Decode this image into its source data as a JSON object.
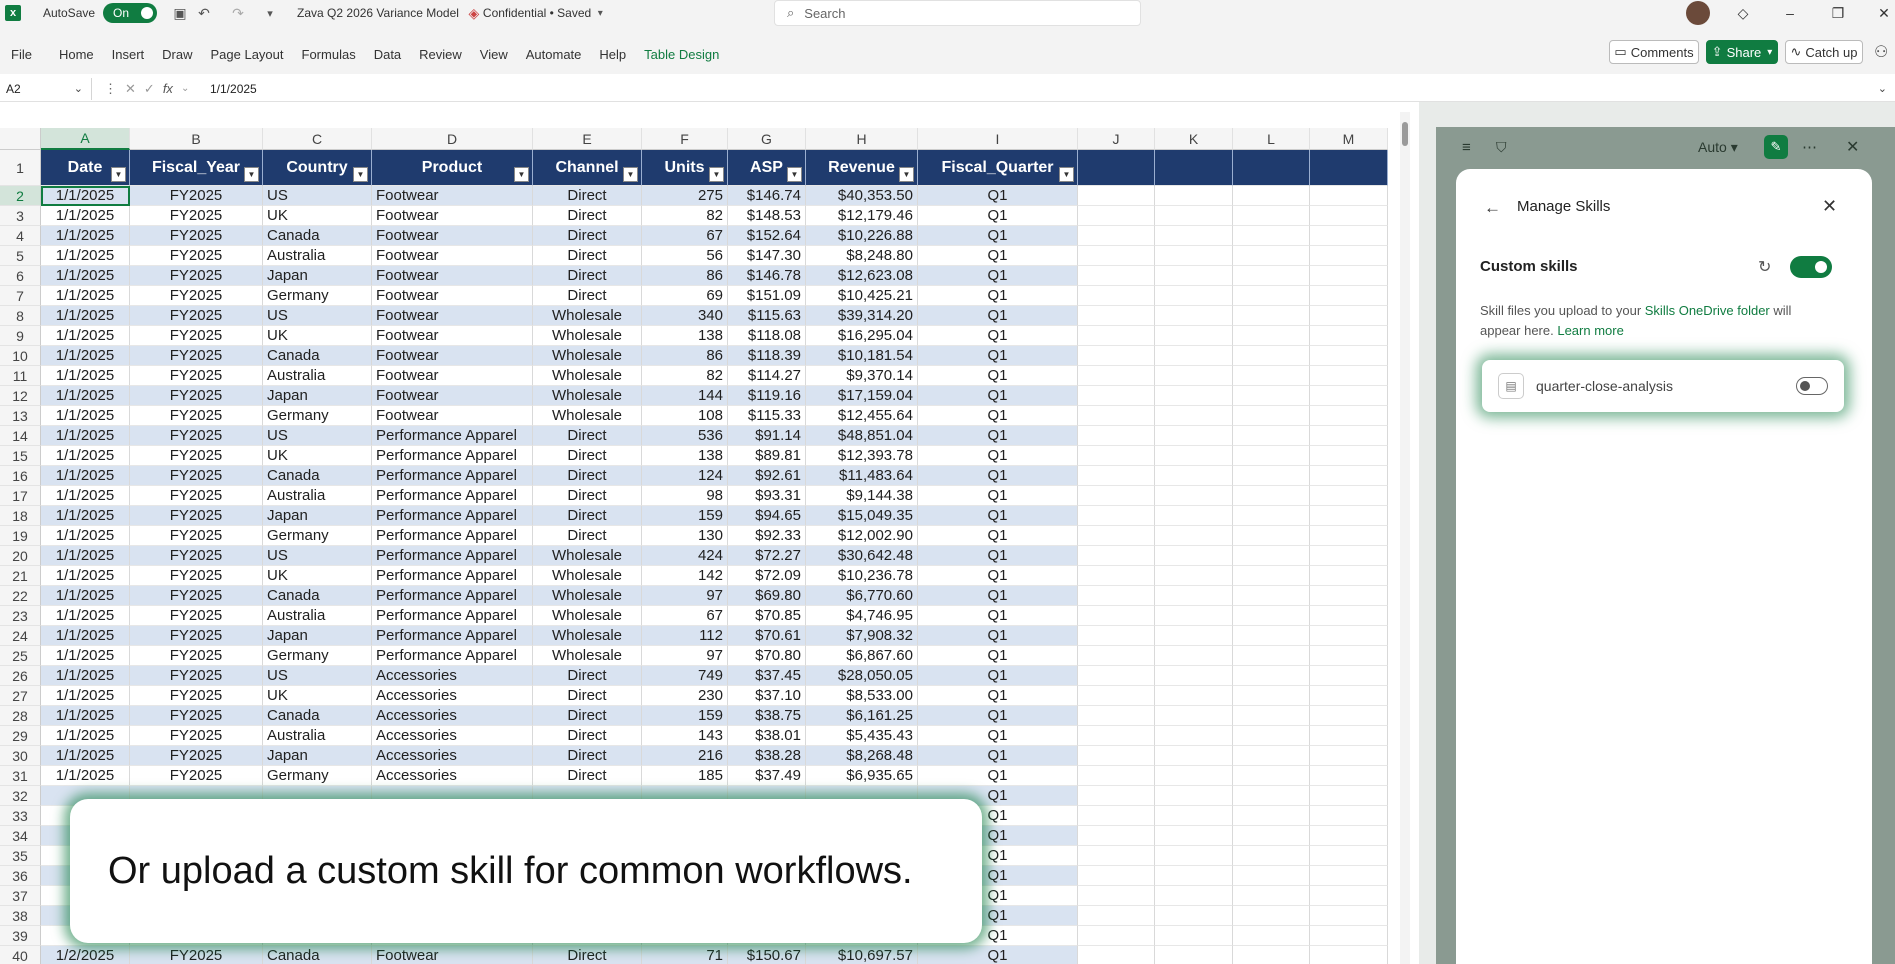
{
  "titlebar": {
    "autosave_label": "AutoSave",
    "autosave_state": "On",
    "doc_title": "Zava Q2 2026 Variance Model",
    "sensitivity": "Confidential • Saved",
    "search_placeholder": "Search"
  },
  "ribbon": {
    "tabs": [
      "File",
      "Home",
      "Insert",
      "Draw",
      "Page Layout",
      "Formulas",
      "Data",
      "Review",
      "View",
      "Automate",
      "Help",
      "Table Design"
    ],
    "active_tab": "Table Design",
    "comments_label": "Comments",
    "share_label": "Share",
    "catchup_label": "Catch up"
  },
  "formula_bar": {
    "name_box": "A2",
    "formula": "1/1/2025"
  },
  "grid": {
    "columns": [
      "A",
      "B",
      "C",
      "D",
      "E",
      "F",
      "G",
      "H",
      "I",
      "J",
      "K",
      "L",
      "M"
    ],
    "headers": [
      "Date",
      "Fiscal_Year",
      "Country",
      "Product",
      "Channel",
      "Units",
      "ASP",
      "Revenue",
      "Fiscal_Quarter"
    ],
    "rows": [
      [
        "1/1/2025",
        "FY2025",
        "US",
        "Footwear",
        "Direct",
        "275",
        "$146.74",
        "$40,353.50",
        "Q1"
      ],
      [
        "1/1/2025",
        "FY2025",
        "UK",
        "Footwear",
        "Direct",
        "82",
        "$148.53",
        "$12,179.46",
        "Q1"
      ],
      [
        "1/1/2025",
        "FY2025",
        "Canada",
        "Footwear",
        "Direct",
        "67",
        "$152.64",
        "$10,226.88",
        "Q1"
      ],
      [
        "1/1/2025",
        "FY2025",
        "Australia",
        "Footwear",
        "Direct",
        "56",
        "$147.30",
        "$8,248.80",
        "Q1"
      ],
      [
        "1/1/2025",
        "FY2025",
        "Japan",
        "Footwear",
        "Direct",
        "86",
        "$146.78",
        "$12,623.08",
        "Q1"
      ],
      [
        "1/1/2025",
        "FY2025",
        "Germany",
        "Footwear",
        "Direct",
        "69",
        "$151.09",
        "$10,425.21",
        "Q1"
      ],
      [
        "1/1/2025",
        "FY2025",
        "US",
        "Footwear",
        "Wholesale",
        "340",
        "$115.63",
        "$39,314.20",
        "Q1"
      ],
      [
        "1/1/2025",
        "FY2025",
        "UK",
        "Footwear",
        "Wholesale",
        "138",
        "$118.08",
        "$16,295.04",
        "Q1"
      ],
      [
        "1/1/2025",
        "FY2025",
        "Canada",
        "Footwear",
        "Wholesale",
        "86",
        "$118.39",
        "$10,181.54",
        "Q1"
      ],
      [
        "1/1/2025",
        "FY2025",
        "Australia",
        "Footwear",
        "Wholesale",
        "82",
        "$114.27",
        "$9,370.14",
        "Q1"
      ],
      [
        "1/1/2025",
        "FY2025",
        "Japan",
        "Footwear",
        "Wholesale",
        "144",
        "$119.16",
        "$17,159.04",
        "Q1"
      ],
      [
        "1/1/2025",
        "FY2025",
        "Germany",
        "Footwear",
        "Wholesale",
        "108",
        "$115.33",
        "$12,455.64",
        "Q1"
      ],
      [
        "1/1/2025",
        "FY2025",
        "US",
        "Performance Apparel",
        "Direct",
        "536",
        "$91.14",
        "$48,851.04",
        "Q1"
      ],
      [
        "1/1/2025",
        "FY2025",
        "UK",
        "Performance Apparel",
        "Direct",
        "138",
        "$89.81",
        "$12,393.78",
        "Q1"
      ],
      [
        "1/1/2025",
        "FY2025",
        "Canada",
        "Performance Apparel",
        "Direct",
        "124",
        "$92.61",
        "$11,483.64",
        "Q1"
      ],
      [
        "1/1/2025",
        "FY2025",
        "Australia",
        "Performance Apparel",
        "Direct",
        "98",
        "$93.31",
        "$9,144.38",
        "Q1"
      ],
      [
        "1/1/2025",
        "FY2025",
        "Japan",
        "Performance Apparel",
        "Direct",
        "159",
        "$94.65",
        "$15,049.35",
        "Q1"
      ],
      [
        "1/1/2025",
        "FY2025",
        "Germany",
        "Performance Apparel",
        "Direct",
        "130",
        "$92.33",
        "$12,002.90",
        "Q1"
      ],
      [
        "1/1/2025",
        "FY2025",
        "US",
        "Performance Apparel",
        "Wholesale",
        "424",
        "$72.27",
        "$30,642.48",
        "Q1"
      ],
      [
        "1/1/2025",
        "FY2025",
        "UK",
        "Performance Apparel",
        "Wholesale",
        "142",
        "$72.09",
        "$10,236.78",
        "Q1"
      ],
      [
        "1/1/2025",
        "FY2025",
        "Canada",
        "Performance Apparel",
        "Wholesale",
        "97",
        "$69.80",
        "$6,770.60",
        "Q1"
      ],
      [
        "1/1/2025",
        "FY2025",
        "Australia",
        "Performance Apparel",
        "Wholesale",
        "67",
        "$70.85",
        "$4,746.95",
        "Q1"
      ],
      [
        "1/1/2025",
        "FY2025",
        "Japan",
        "Performance Apparel",
        "Wholesale",
        "112",
        "$70.61",
        "$7,908.32",
        "Q1"
      ],
      [
        "1/1/2025",
        "FY2025",
        "Germany",
        "Performance Apparel",
        "Wholesale",
        "97",
        "$70.80",
        "$6,867.60",
        "Q1"
      ],
      [
        "1/1/2025",
        "FY2025",
        "US",
        "Accessories",
        "Direct",
        "749",
        "$37.45",
        "$28,050.05",
        "Q1"
      ],
      [
        "1/1/2025",
        "FY2025",
        "UK",
        "Accessories",
        "Direct",
        "230",
        "$37.10",
        "$8,533.00",
        "Q1"
      ],
      [
        "1/1/2025",
        "FY2025",
        "Canada",
        "Accessories",
        "Direct",
        "159",
        "$38.75",
        "$6,161.25",
        "Q1"
      ],
      [
        "1/1/2025",
        "FY2025",
        "Australia",
        "Accessories",
        "Direct",
        "143",
        "$38.01",
        "$5,435.43",
        "Q1"
      ],
      [
        "1/1/2025",
        "FY2025",
        "Japan",
        "Accessories",
        "Direct",
        "216",
        "$38.28",
        "$8,268.48",
        "Q1"
      ],
      [
        "1/1/2025",
        "FY2025",
        "Germany",
        "Accessories",
        "Direct",
        "185",
        "$37.49",
        "$6,935.65",
        "Q1"
      ],
      [
        "",
        "",
        "",
        "",
        "",
        "",
        "",
        "",
        "Q1"
      ],
      [
        "",
        "",
        "",
        "",
        "",
        "",
        "",
        "",
        "Q1"
      ],
      [
        "",
        "",
        "",
        "",
        "",
        "",
        "",
        "",
        "Q1"
      ],
      [
        "",
        "",
        "",
        "",
        "",
        "",
        "",
        "",
        "Q1"
      ],
      [
        "",
        "",
        "",
        "",
        "",
        "",
        "",
        "",
        "Q1"
      ],
      [
        "",
        "",
        "",
        "",
        "",
        "",
        "",
        "",
        "Q1"
      ],
      [
        "",
        "",
        "",
        "",
        "",
        "",
        "",
        "",
        "Q1"
      ],
      [
        "",
        "",
        "",
        "",
        "",
        "",
        "",
        "",
        "Q1"
      ],
      [
        "1/2/2025",
        "FY2025",
        "Canada",
        "Footwear",
        "Direct",
        "71",
        "$150.67",
        "$10,697.57",
        "Q1"
      ]
    ]
  },
  "pane": {
    "mode": "Auto",
    "dialog_title": "Manage Skills",
    "section_title": "Custom skills",
    "desc_prefix": "Skill files you upload to your ",
    "desc_link": "Skills OneDrive folder",
    "desc_mid": " will appear here. ",
    "desc_learn": "Learn more",
    "skill_name": "quarter-close-analysis"
  },
  "caption": "Or upload a custom skill for common workflows.",
  "colors": {
    "accent": "#107c41",
    "table_header": "#1f3b6e",
    "band": "#d9e3f1"
  }
}
